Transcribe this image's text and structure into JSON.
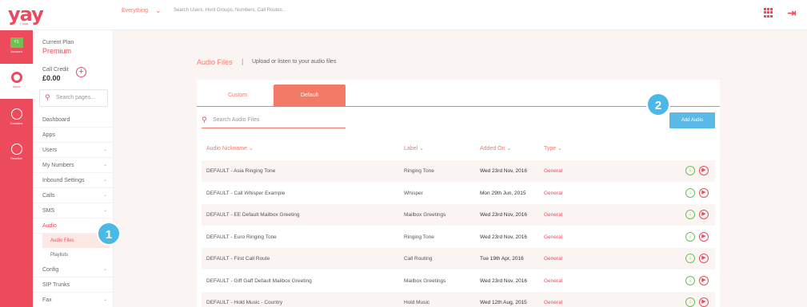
{
  "topbar": {
    "logo": "yay",
    "logo_sub": "• com",
    "scope_label": "Everything",
    "scope_chevron": "⌄",
    "search_placeholder": "Search Users, Hunt Groups, Numbers, Call Routes...",
    "apps_icon": "grid-icon",
    "logout_icon": "logout-icon"
  },
  "rail": {
    "account": {
      "avatar": "Y1",
      "label": "Account"
    },
    "voice": {
      "label": "Voice"
    },
    "domains": {
      "label": "Domains"
    },
    "reseller": {
      "label": "Reseller"
    }
  },
  "nav": {
    "plan_caption": "Current Plan",
    "plan_value": "Premium",
    "credit_caption": "Call Credit",
    "credit_value": "£0.00",
    "credit_add": "+",
    "search_placeholder": "Search pages...",
    "items": [
      {
        "label": "Dashboard",
        "chevron": ""
      },
      {
        "label": "Apps",
        "chevron": ""
      },
      {
        "label": "Users",
        "chevron": "⌄"
      },
      {
        "label": "My Numbers",
        "chevron": "⌄"
      },
      {
        "label": "Inbound Settings",
        "chevron": "⌄"
      },
      {
        "label": "Calls",
        "chevron": "⌄"
      },
      {
        "label": "SMS",
        "chevron": "⌄"
      },
      {
        "label": "Audio",
        "chevron": ""
      }
    ],
    "sub_items": [
      {
        "label": "Audio Files"
      },
      {
        "label": "Playlists"
      }
    ],
    "items_after": [
      {
        "label": "Config",
        "chevron": "⌄"
      },
      {
        "label": "SIP Trunks",
        "chevron": ""
      },
      {
        "label": "Fax",
        "chevron": "⌄"
      }
    ]
  },
  "badges": {
    "one": "1",
    "two": "2"
  },
  "page": {
    "title": "Audio Files",
    "separator": "|",
    "description": "Upload or listen to your audio files"
  },
  "tabs": [
    {
      "label": "Custom",
      "active": false
    },
    {
      "label": "Default",
      "active": true
    }
  ],
  "search": {
    "placeholder": "Search Audio Files"
  },
  "add_button": "Add Audio",
  "columns": [
    "Audio Nickname ⌄",
    "Label ⌄",
    "Added On ⌄",
    "Type ⌄"
  ],
  "rows": [
    {
      "nickname": "DEFAULT - Asia Ringing Tone",
      "label": "Ringing Tone",
      "added_on": "Wed 23rd Nov, 2016",
      "type": "General"
    },
    {
      "nickname": "DEFAULT - Call Whisper Example",
      "label": "Whisper",
      "added_on": "Mon 29th Jun, 2015",
      "type": "General"
    },
    {
      "nickname": "DEFAULT - EE Default Mailbox Greeting",
      "label": "Mailbox Greetings",
      "added_on": "Wed 23rd Nov, 2016",
      "type": "General"
    },
    {
      "nickname": "DEFAULT - Euro Ringing Tone",
      "label": "Ringing Tone",
      "added_on": "Wed 23rd Nov, 2016",
      "type": "General"
    },
    {
      "nickname": "DEFAULT - First Call Route",
      "label": "Call Routing",
      "added_on": "Tue 19th Apr, 2016",
      "type": "General"
    },
    {
      "nickname": "DEFAULT - Giff Gaff Default Mailbox Greeting",
      "label": "Mailbox Greetings",
      "added_on": "Wed 23rd Nov, 2016",
      "type": "General"
    },
    {
      "nickname": "DEFAULT - Hold Music - Country",
      "label": "Hold Music",
      "added_on": "Wed 12th Aug, 2015",
      "type": "General"
    }
  ],
  "row_actions": {
    "download": "↓",
    "play": "▶"
  },
  "colors": {
    "brand": "#ec4a5d",
    "accent": "#f37a66",
    "button": "#5ab9e6",
    "download": "#6fc24f"
  }
}
